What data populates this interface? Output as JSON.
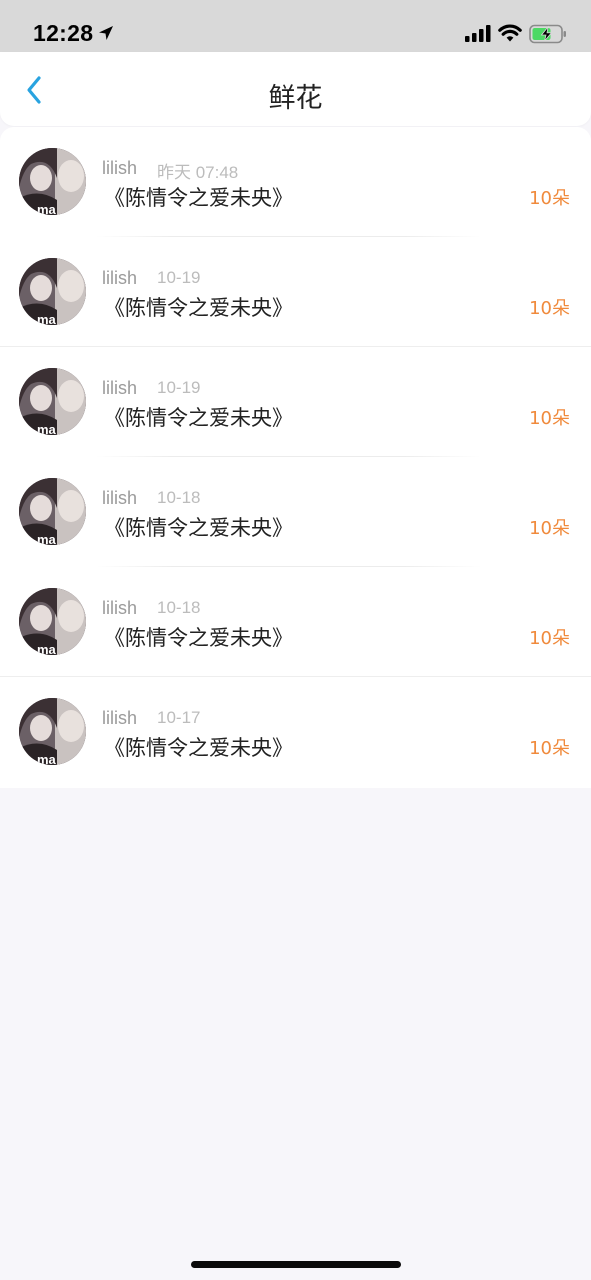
{
  "status_bar": {
    "time": "12:28",
    "icons": [
      "location-arrow-icon",
      "cellular-signal-icon",
      "wifi-icon",
      "battery-charging-icon"
    ]
  },
  "nav": {
    "back_icon": "chevron-left-icon",
    "title": "鲜花"
  },
  "colors": {
    "accent": "#29a3e0",
    "flower_count": "#f08a3c",
    "username": "#9b9b9b",
    "timestamp": "#bcbcbc",
    "title_text": "#222222",
    "background": "#f7f6fa"
  },
  "items": [
    {
      "user": "lilish",
      "time": "昨天 07:48",
      "title": "《陈情令之爱未央》",
      "count": "10朵"
    },
    {
      "user": "lilish",
      "time": "10-19",
      "title": "《陈情令之爱未央》",
      "count": "10朵"
    },
    {
      "user": "lilish",
      "time": "10-19",
      "title": "《陈情令之爱未央》",
      "count": "10朵"
    },
    {
      "user": "lilish",
      "time": "10-18",
      "title": "《陈情令之爱未央》",
      "count": "10朵"
    },
    {
      "user": "lilish",
      "time": "10-18",
      "title": "《陈情令之爱未央》",
      "count": "10朵"
    },
    {
      "user": "lilish",
      "time": "10-17",
      "title": "《陈情令之爱未央》",
      "count": "10朵"
    }
  ]
}
